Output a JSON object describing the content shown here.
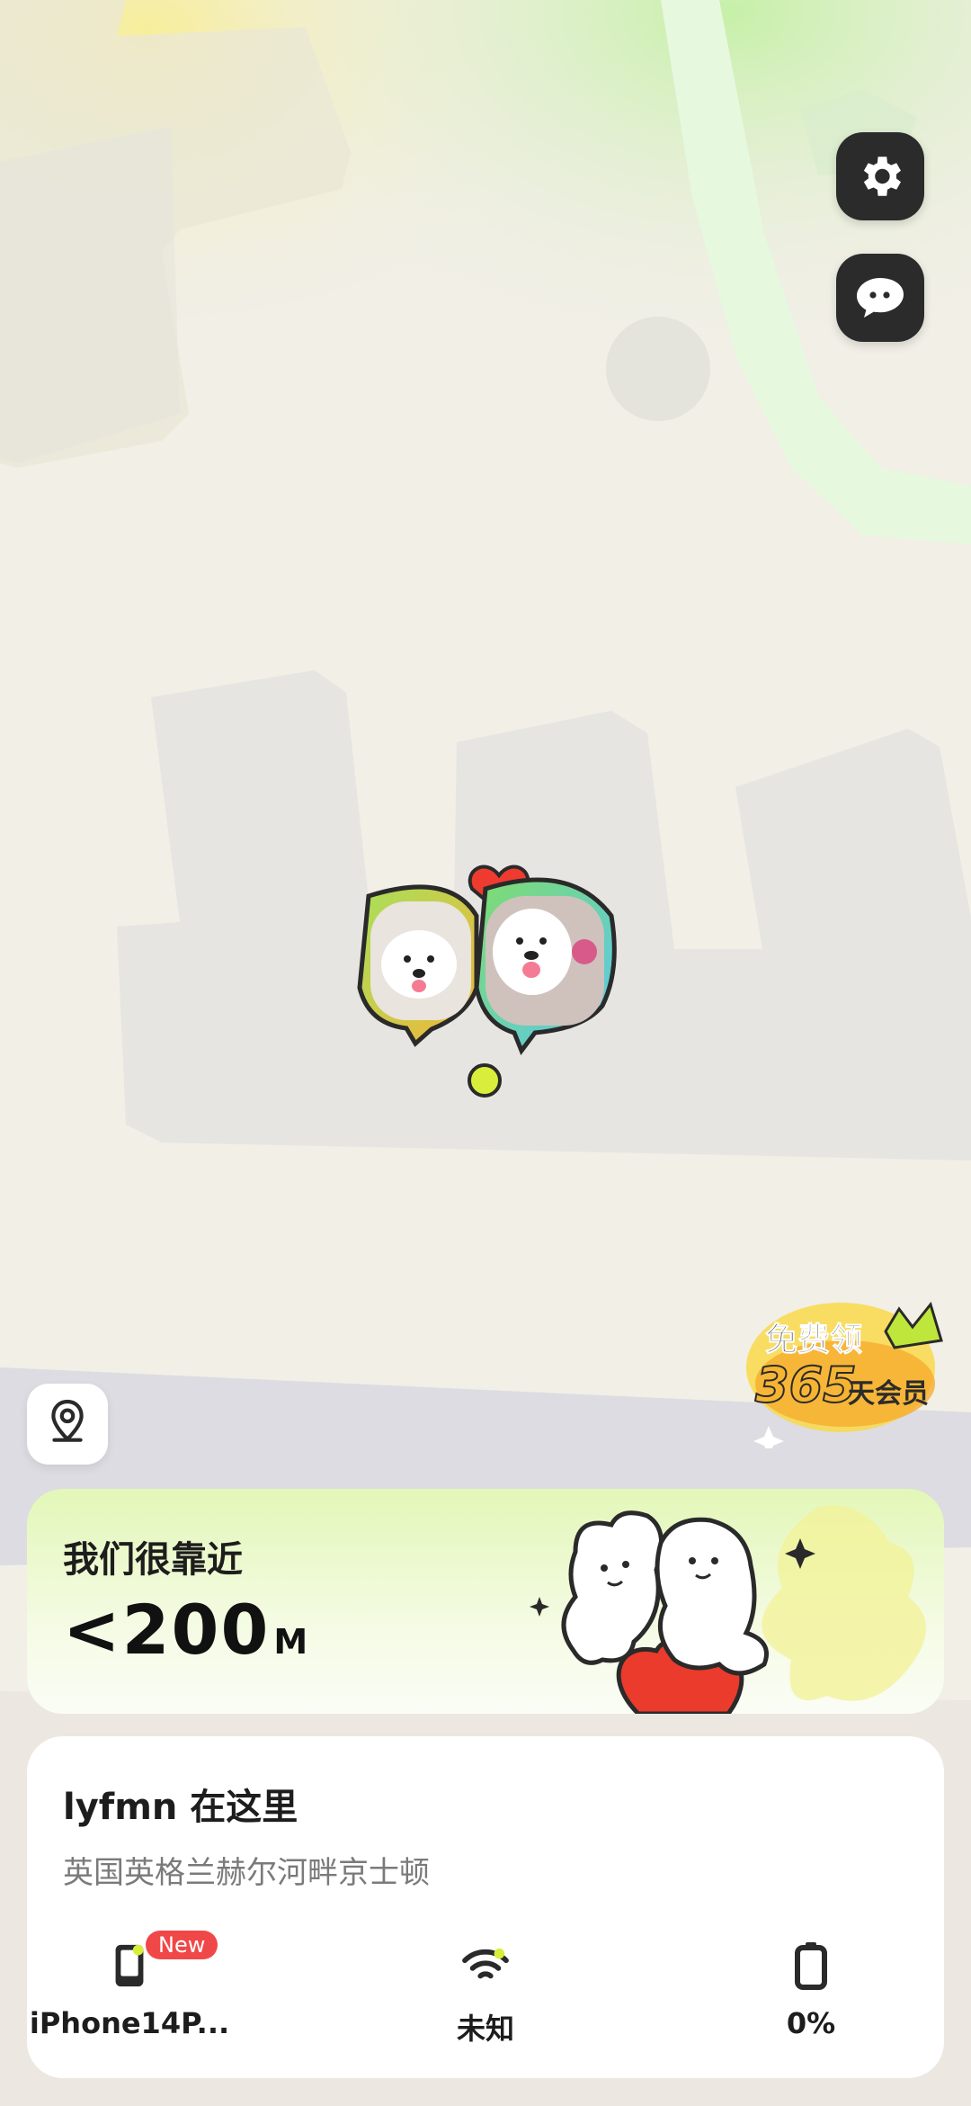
{
  "map": {
    "settings_icon": "gear-icon",
    "chat_icon": "chat-bubble-icon",
    "locate_icon": "location-pin-icon"
  },
  "promo": {
    "line1": "免费领",
    "line2_number": "365",
    "line2_text": "天会员"
  },
  "proximity": {
    "title": "我们很靠近",
    "distance_value": "<200",
    "distance_unit": "M"
  },
  "user_info": {
    "title": "lyfmn 在这里",
    "address": "英国英格兰赫尔河畔京士顿",
    "stats": [
      {
        "icon": "phone-icon",
        "label": "iPhone14P...",
        "badge": "New"
      },
      {
        "icon": "wifi-icon",
        "label": "未知"
      },
      {
        "icon": "battery-icon",
        "label": "0%"
      }
    ]
  },
  "colors": {
    "accent_green": "#d8ee3a",
    "badge_red": "#f04848",
    "dark_button": "#2b2b2b"
  }
}
